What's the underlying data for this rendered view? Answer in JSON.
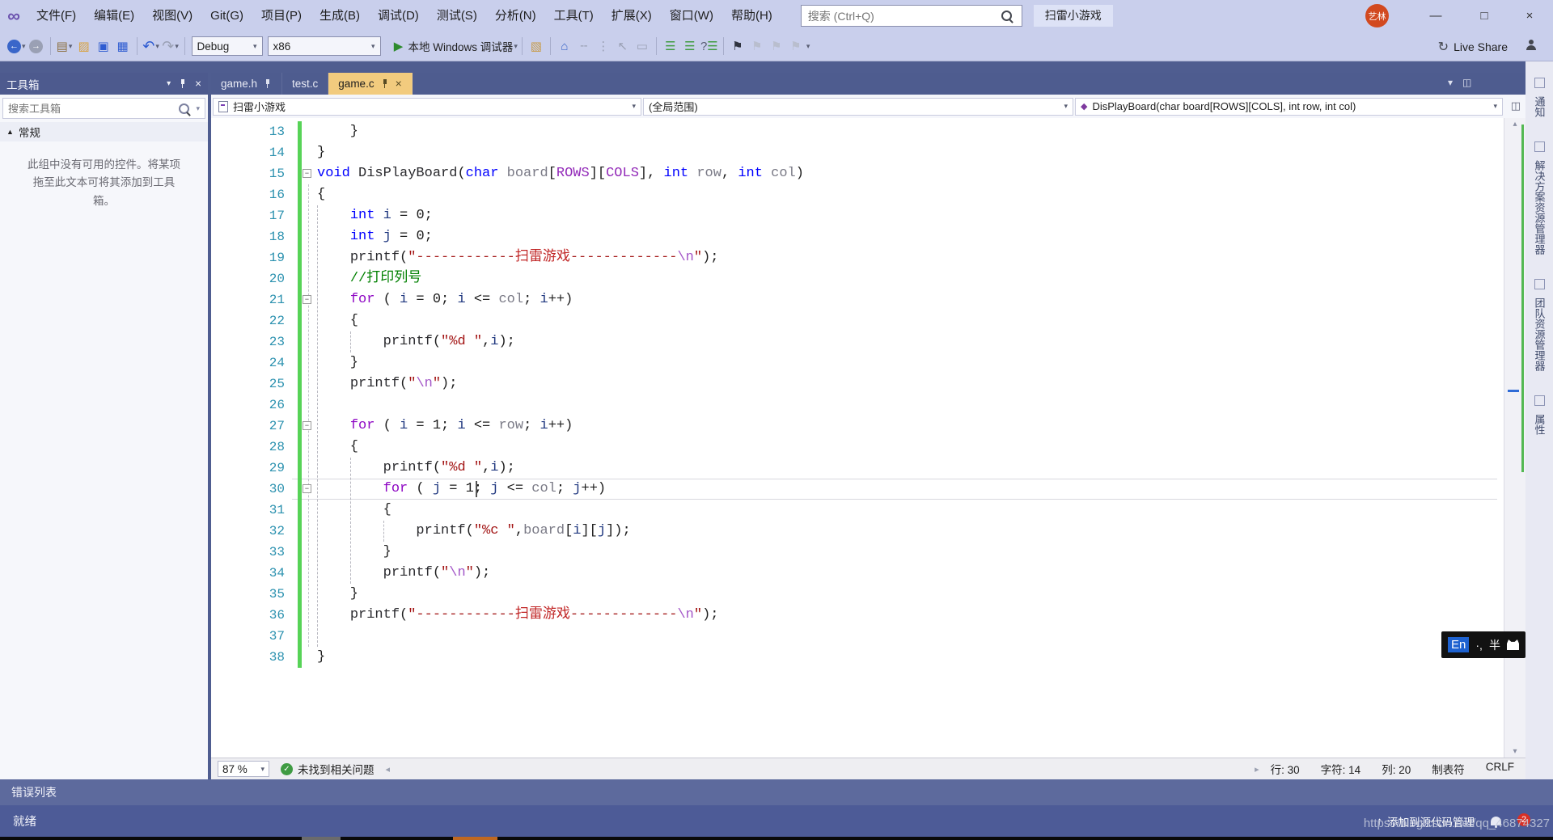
{
  "icons": {
    "vs_logo": "∞",
    "back": "←",
    "forward": "→",
    "caret": "▾",
    "new_project": "▤",
    "open_file": "▨",
    "save": "▣",
    "save_all": "▦",
    "undo": "↶",
    "redo": "↷",
    "play": "▶",
    "folder_search": "▧",
    "home": "⌂",
    "minus_box": "╌",
    "dots": "⋮",
    "pointer": "↖",
    "copy": "▭",
    "indent_a": "☰",
    "indent_b": "☰",
    "help_list": "?",
    "bookmark": "⚑",
    "bm_prev": "⚑",
    "bm_next": "⚑",
    "bm_clear": "⚑",
    "live_share": "↻",
    "split": "◫",
    "tab_menu": "▾",
    "tab_list": "◫",
    "scm_up": "↑",
    "check": "✓",
    "close": "×",
    "min": "—",
    "max": "□",
    "section_collapse": "▲",
    "scroll_up": "▴",
    "scroll_down": "▾",
    "scroll_left": "◂",
    "scroll_right": "▸",
    "fold_minus": "−",
    "method": "◆"
  },
  "titlebar": {
    "menus": [
      {
        "key": "file",
        "label": "文件(F)"
      },
      {
        "key": "edit",
        "label": "编辑(E)"
      },
      {
        "key": "view",
        "label": "视图(V)"
      },
      {
        "key": "git",
        "label": "Git(G)"
      },
      {
        "key": "project",
        "label": "项目(P)"
      },
      {
        "key": "build",
        "label": "生成(B)"
      },
      {
        "key": "debug",
        "label": "调试(D)"
      },
      {
        "key": "test",
        "label": "测试(S)"
      },
      {
        "key": "analyze",
        "label": "分析(N)"
      },
      {
        "key": "tools",
        "label": "工具(T)"
      },
      {
        "key": "extensions",
        "label": "扩展(X)"
      },
      {
        "key": "window",
        "label": "窗口(W)"
      },
      {
        "key": "help",
        "label": "帮助(H)"
      }
    ],
    "search_placeholder": "搜索 (Ctrl+Q)",
    "solution": "扫雷小游戏",
    "avatar": "艺林"
  },
  "toolbar": {
    "debug_config": "Debug",
    "platform": "x86",
    "run_label": "本地 Windows 调试器",
    "live_share": "Live Share"
  },
  "tabs": [
    {
      "label": "game.h",
      "pinned": true,
      "active": false,
      "closable": false
    },
    {
      "label": "test.c",
      "pinned": false,
      "active": false,
      "closable": false
    },
    {
      "label": "game.c",
      "pinned": true,
      "active": true,
      "closable": true
    }
  ],
  "navbar": {
    "project": "扫雷小游戏",
    "scope": "(全局范围)",
    "member": "DisPlayBoard(char board[ROWS][COLS], int row, int col)"
  },
  "toolbox": {
    "title": "工具箱",
    "search_placeholder": "搜索工具箱",
    "section": "常规",
    "empty_text": "此组中没有可用的控件。将某项拖至此文本可将其添加到工具箱。"
  },
  "right_tabs": [
    "通知",
    "解决方案资源管理器",
    "团队资源管理器",
    "属性"
  ],
  "editor": {
    "lines": [
      {
        "n": 13,
        "t": [
          [
            "    }",
            "pl"
          ]
        ]
      },
      {
        "n": 14,
        "t": [
          [
            "}",
            "pl"
          ]
        ]
      },
      {
        "n": 15,
        "fold": true,
        "t": [
          [
            "void",
            "kw"
          ],
          [
            " ",
            "pl"
          ],
          [
            "DisPlayBoard",
            "fn"
          ],
          [
            "(",
            "pl"
          ],
          [
            "char",
            "kw"
          ],
          [
            " ",
            "pl"
          ],
          [
            "board",
            "pr"
          ],
          [
            "[",
            "pl"
          ],
          [
            "ROWS",
            "mc"
          ],
          [
            "][",
            "pl"
          ],
          [
            "COLS",
            "mc"
          ],
          [
            "]",
            "pl"
          ],
          [
            ", ",
            "pl"
          ],
          [
            "int",
            "kw"
          ],
          [
            " ",
            "pl"
          ],
          [
            "row",
            "pr"
          ],
          [
            ", ",
            "pl"
          ],
          [
            "int",
            "kw"
          ],
          [
            " ",
            "pl"
          ],
          [
            "col",
            "pr"
          ],
          [
            ")",
            "pl"
          ]
        ]
      },
      {
        "n": 16,
        "t": [
          [
            "{",
            "pl"
          ]
        ]
      },
      {
        "n": 17,
        "t": [
          [
            "    ",
            "pl"
          ],
          [
            "int",
            "kw"
          ],
          [
            " ",
            "pl"
          ],
          [
            "i",
            "vr"
          ],
          [
            " = ",
            "pl"
          ],
          [
            "0",
            "nm"
          ],
          [
            ";",
            "pl"
          ]
        ]
      },
      {
        "n": 18,
        "t": [
          [
            "    ",
            "pl"
          ],
          [
            "int",
            "kw"
          ],
          [
            " ",
            "pl"
          ],
          [
            "j",
            "vr"
          ],
          [
            " = ",
            "pl"
          ],
          [
            "0",
            "nm"
          ],
          [
            ";",
            "pl"
          ]
        ]
      },
      {
        "n": 19,
        "t": [
          [
            "    ",
            "pl"
          ],
          [
            "printf",
            "fn"
          ],
          [
            "(",
            "pl"
          ],
          [
            "\"------------",
            "st"
          ],
          [
            "扫雷游戏",
            "stc"
          ],
          [
            "-------------",
            "st"
          ],
          [
            "\\n",
            "se"
          ],
          [
            "\"",
            "st"
          ],
          [
            ");",
            "pl"
          ]
        ]
      },
      {
        "n": 20,
        "t": [
          [
            "    ",
            "pl"
          ],
          [
            "//打印列号",
            "cm"
          ]
        ]
      },
      {
        "n": 21,
        "fold": true,
        "t": [
          [
            "    ",
            "pl"
          ],
          [
            "for",
            "ctrl"
          ],
          [
            " ( ",
            "pl"
          ],
          [
            "i",
            "vr"
          ],
          [
            " = ",
            "pl"
          ],
          [
            "0",
            "nm"
          ],
          [
            "; ",
            "pl"
          ],
          [
            "i",
            "vr"
          ],
          [
            " <= ",
            "pl"
          ],
          [
            "col",
            "pr"
          ],
          [
            "; ",
            "pl"
          ],
          [
            "i",
            "vr"
          ],
          [
            "++)",
            "pl"
          ]
        ]
      },
      {
        "n": 22,
        "t": [
          [
            "    {",
            "pl"
          ]
        ]
      },
      {
        "n": 23,
        "t": [
          [
            "        ",
            "pl"
          ],
          [
            "printf",
            "fn"
          ],
          [
            "(",
            "pl"
          ],
          [
            "\"%d \"",
            "st"
          ],
          [
            ",",
            "pl"
          ],
          [
            "i",
            "vr"
          ],
          [
            ");",
            "pl"
          ]
        ]
      },
      {
        "n": 24,
        "t": [
          [
            "    }",
            "pl"
          ]
        ]
      },
      {
        "n": 25,
        "t": [
          [
            "    ",
            "pl"
          ],
          [
            "printf",
            "fn"
          ],
          [
            "(",
            "pl"
          ],
          [
            "\"",
            "st"
          ],
          [
            "\\n",
            "se"
          ],
          [
            "\"",
            "st"
          ],
          [
            ");",
            "pl"
          ]
        ]
      },
      {
        "n": 26,
        "t": []
      },
      {
        "n": 27,
        "fold": true,
        "t": [
          [
            "    ",
            "pl"
          ],
          [
            "for",
            "ctrl"
          ],
          [
            " ( ",
            "pl"
          ],
          [
            "i",
            "vr"
          ],
          [
            " = ",
            "pl"
          ],
          [
            "1",
            "nm"
          ],
          [
            "; ",
            "pl"
          ],
          [
            "i",
            "vr"
          ],
          [
            " <= ",
            "pl"
          ],
          [
            "row",
            "pr"
          ],
          [
            "; ",
            "pl"
          ],
          [
            "i",
            "vr"
          ],
          [
            "++)",
            "pl"
          ]
        ]
      },
      {
        "n": 28,
        "t": [
          [
            "    {",
            "pl"
          ]
        ]
      },
      {
        "n": 29,
        "t": [
          [
            "        ",
            "pl"
          ],
          [
            "printf",
            "fn"
          ],
          [
            "(",
            "pl"
          ],
          [
            "\"%d \"",
            "st"
          ],
          [
            ",",
            "pl"
          ],
          [
            "i",
            "vr"
          ],
          [
            ");",
            "pl"
          ]
        ]
      },
      {
        "n": 30,
        "fold": true,
        "current": true,
        "t": [
          [
            "        ",
            "pl"
          ],
          [
            "for",
            "ctrl"
          ],
          [
            " ( ",
            "pl"
          ],
          [
            "j",
            "vr"
          ],
          [
            " = ",
            "pl"
          ],
          [
            "1",
            "nm"
          ],
          [
            "; ",
            "pl"
          ],
          [
            "j",
            "vr"
          ],
          [
            " <= ",
            "pl"
          ],
          [
            "col",
            "pr"
          ],
          [
            "; ",
            "pl"
          ],
          [
            "j",
            "vr"
          ],
          [
            "++)",
            "pl"
          ]
        ]
      },
      {
        "n": 31,
        "t": [
          [
            "        {",
            "pl"
          ]
        ]
      },
      {
        "n": 32,
        "t": [
          [
            "            ",
            "pl"
          ],
          [
            "printf",
            "fn"
          ],
          [
            "(",
            "pl"
          ],
          [
            "\"%c \"",
            "st"
          ],
          [
            ",",
            "pl"
          ],
          [
            "board",
            "pr"
          ],
          [
            "[",
            "pl"
          ],
          [
            "i",
            "vr"
          ],
          [
            "][",
            "pl"
          ],
          [
            "j",
            "vr"
          ],
          [
            "]);",
            "pl"
          ]
        ]
      },
      {
        "n": 33,
        "t": [
          [
            "        }",
            "pl"
          ]
        ]
      },
      {
        "n": 34,
        "t": [
          [
            "        ",
            "pl"
          ],
          [
            "printf",
            "fn"
          ],
          [
            "(",
            "pl"
          ],
          [
            "\"",
            "st"
          ],
          [
            "\\n",
            "se"
          ],
          [
            "\"",
            "st"
          ],
          [
            ");",
            "pl"
          ]
        ]
      },
      {
        "n": 35,
        "t": [
          [
            "    }",
            "pl"
          ]
        ]
      },
      {
        "n": 36,
        "t": [
          [
            "    ",
            "pl"
          ],
          [
            "printf",
            "fn"
          ],
          [
            "(",
            "pl"
          ],
          [
            "\"------------",
            "st"
          ],
          [
            "扫雷游戏",
            "stc"
          ],
          [
            "-------------",
            "st"
          ],
          [
            "\\n",
            "se"
          ],
          [
            "\"",
            "st"
          ],
          [
            ");",
            "pl"
          ]
        ]
      },
      {
        "n": 37,
        "t": []
      },
      {
        "n": 38,
        "t": [
          [
            "}",
            "pl"
          ]
        ]
      }
    ],
    "current_line": 30
  },
  "bottom_bar": {
    "zoom": "87 %",
    "problems": "未找到相关问题",
    "line": "行: 30",
    "chr": "字符: 14",
    "col": "列: 20",
    "tabs": "制表符",
    "eol": "CRLF"
  },
  "panels": {
    "error_list": "错误列表",
    "status": "就绪",
    "scm": "添加到源代码管理",
    "watermark": "https://blog.csdn.net/qq_46874327",
    "badge": "2"
  },
  "ime": {
    "lang": "En",
    "punct": "·,",
    "width": "半"
  }
}
